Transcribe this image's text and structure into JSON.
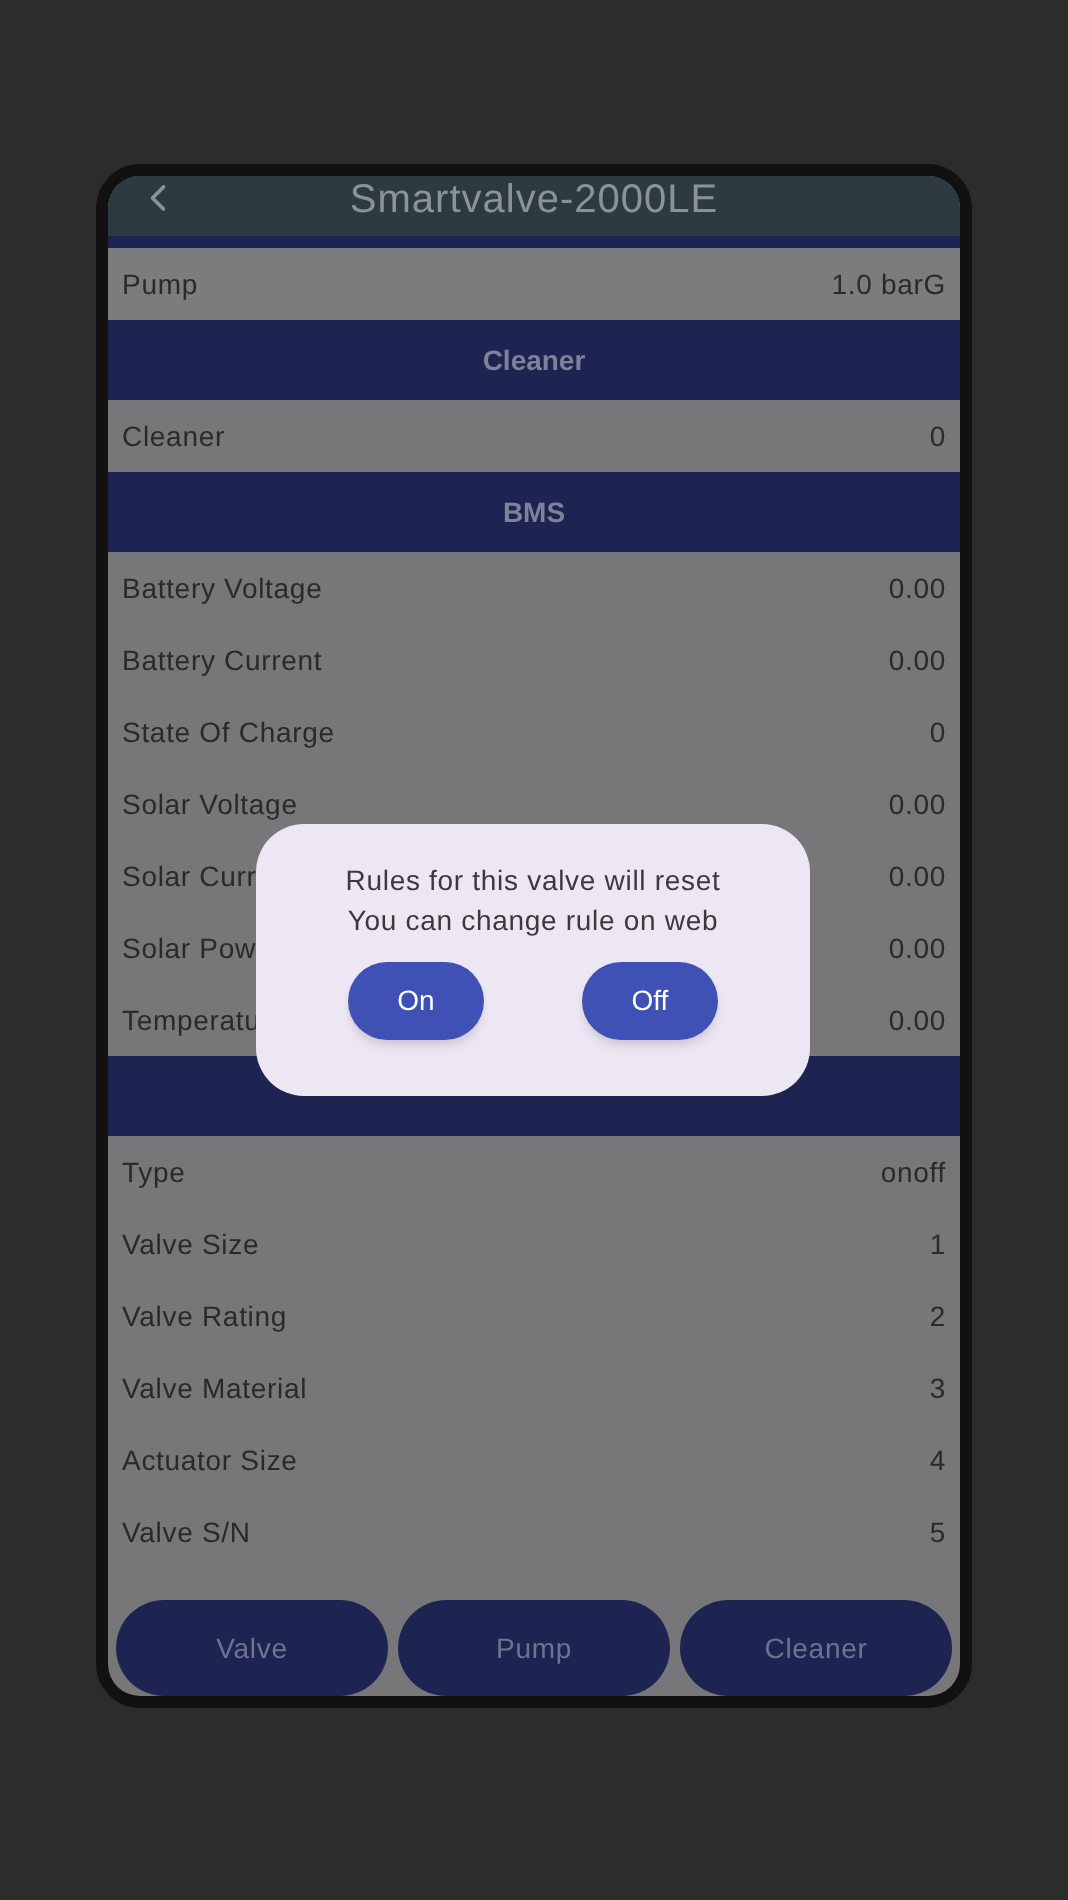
{
  "header": {
    "title": "Smartvalve-2000LE"
  },
  "sections": [
    {
      "rows": [
        {
          "label": "Pump",
          "value": "1.0 barG"
        }
      ]
    },
    {
      "title": "Cleaner",
      "rows": [
        {
          "label": "Cleaner",
          "value": "0"
        }
      ]
    },
    {
      "title": "BMS",
      "rows": [
        {
          "label": "Battery Voltage",
          "value": "0.00"
        },
        {
          "label": "Battery Current",
          "value": "0.00"
        },
        {
          "label": "State Of Charge",
          "value": "0"
        },
        {
          "label": "Solar Voltage",
          "value": "0.00"
        },
        {
          "label": "Solar Curr",
          "value": "0.00"
        },
        {
          "label": "Solar Pow",
          "value": "0.00"
        },
        {
          "label": "Temperatu",
          "value": "0.00"
        }
      ]
    },
    {
      "rows": [
        {
          "label": "Type",
          "value": "onoff"
        },
        {
          "label": "Valve Size",
          "value": "1"
        },
        {
          "label": "Valve Rating",
          "value": "2"
        },
        {
          "label": "Valve Material",
          "value": "3"
        },
        {
          "label": "Actuator Size",
          "value": "4"
        },
        {
          "label": "Valve S/N",
          "value": "5"
        }
      ]
    }
  ],
  "bottom_buttons": [
    "Valve",
    "Pump",
    "Cleaner"
  ],
  "dialog": {
    "lines": [
      "Rules for this valve will reset",
      "You can change rule on web"
    ],
    "buttons": [
      "On",
      "Off"
    ]
  }
}
